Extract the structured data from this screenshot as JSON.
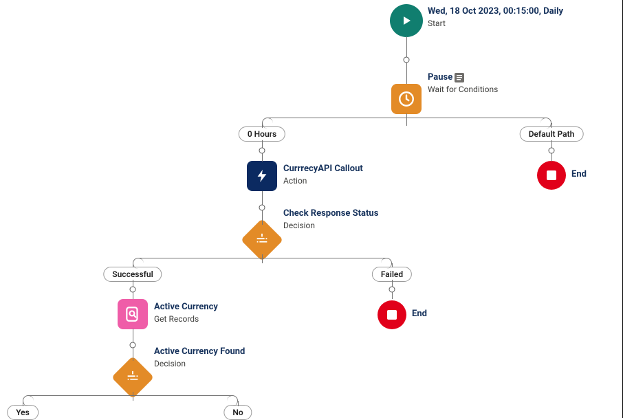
{
  "nodes": {
    "start": {
      "title": "Wed, 18 Oct 2023, 00:15:00, Daily",
      "subtitle": "Start",
      "color": "#107e6f"
    },
    "pause": {
      "title": "Pause",
      "subtitle": "Wait for Conditions",
      "color": "#e38b27"
    },
    "api": {
      "title": "CurrrecyAPI Callout",
      "subtitle": "Action",
      "color": "#0b2a61"
    },
    "checkResponse": {
      "title": "Check Response Status",
      "subtitle": "Decision",
      "color": "#e38b27"
    },
    "activeCurrency": {
      "title": "Active Currency",
      "subtitle": "Get Records",
      "color": "#ef5da8"
    },
    "activeCurrencyFound": {
      "title": "Active Currency Found",
      "subtitle": "Decision",
      "color": "#e38b27"
    },
    "end1": {
      "label": "End",
      "color": "#e1001a"
    },
    "end2": {
      "label": "End",
      "color": "#e1001a"
    }
  },
  "paths": {
    "hours": "0 Hours",
    "defaultPath": "Default Path",
    "successful": "Successful",
    "failed": "Failed",
    "yes": "Yes",
    "no": "No"
  }
}
